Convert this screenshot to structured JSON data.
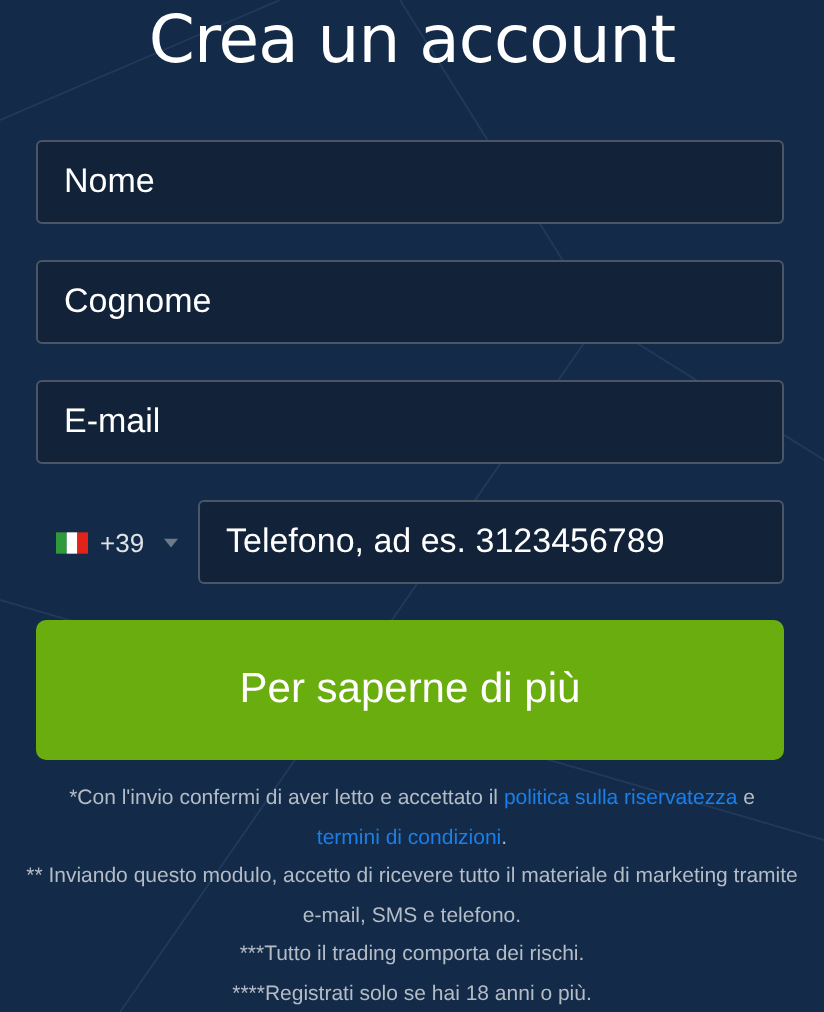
{
  "title": "Crea un account",
  "fields": [
    {
      "placeholder": "Nome"
    },
    {
      "placeholder": "Cognome"
    },
    {
      "placeholder": "E-mail"
    }
  ],
  "phone": {
    "country_code": "+39",
    "placeholder": "Telefono, ad es. 3123456789"
  },
  "submit_button": "Per saperne di più",
  "consent": {
    "text_1": "*Con l'invio confermi di aver letto e accettato il ",
    "link_1": "politica sulla riservatezza",
    "text_2": " e ",
    "link_2": "termini di condizioni",
    "text_3": "."
  },
  "notes": [
    "** Inviando questo modulo, accetto di ricevere tutto il materiale di marketing tramite e-mail, SMS e telefono.",
    "***Tutto il trading comporta dei rischi.",
    "****Registrati solo se hai 18 anni o più."
  ]
}
